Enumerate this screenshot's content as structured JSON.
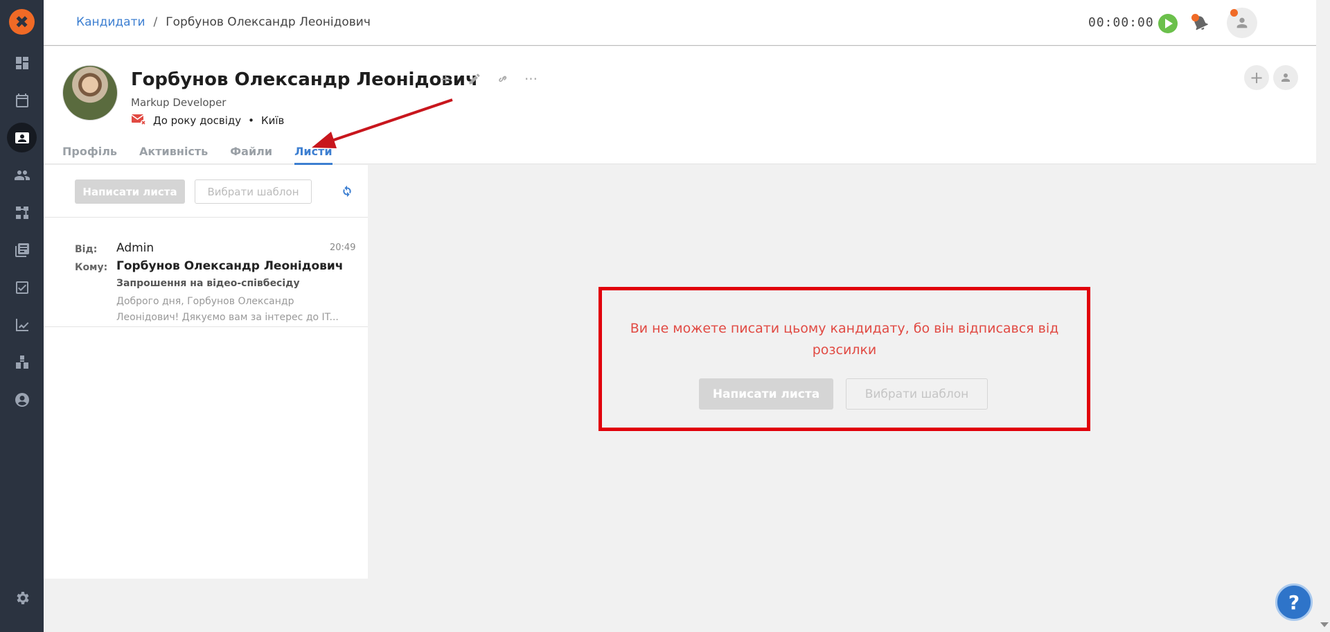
{
  "app": {
    "logo_glyph": "✖",
    "accent_color": "#f06a26",
    "link_color": "#3d7fd1"
  },
  "sidebar": {
    "items": [
      {
        "icon": "dashboard-icon"
      },
      {
        "icon": "calendar-icon"
      },
      {
        "icon": "candidates-icon",
        "active": true
      },
      {
        "icon": "people-icon"
      },
      {
        "icon": "hierarchy-icon"
      },
      {
        "icon": "library-icon"
      },
      {
        "icon": "tasks-icon"
      },
      {
        "icon": "analytics-icon"
      },
      {
        "icon": "boxes-icon"
      },
      {
        "icon": "account-icon"
      },
      {
        "icon": "settings-icon"
      }
    ]
  },
  "topbar": {
    "breadcrumb": {
      "parent": "Кандидати",
      "separator": "/",
      "current": "Горбунов Олександр Леонідович"
    },
    "timer": "00:00:00"
  },
  "candidate": {
    "name": "Горбунов Олександр Леонідович",
    "position": "Markup Developer",
    "experience": "До року досвіду",
    "meta_separator": "•",
    "city": "Київ",
    "tools": {
      "add": "+",
      "more": "···"
    }
  },
  "header_actions": {
    "add": "+"
  },
  "tabs": [
    {
      "label": "Профіль",
      "active": false
    },
    {
      "label": "Активність",
      "active": false
    },
    {
      "label": "Файли",
      "active": false
    },
    {
      "label": "Листи",
      "active": true
    }
  ],
  "mail_panel": {
    "write_label": "Написати листа",
    "template_label": "Вибрати шаблон",
    "items": [
      {
        "from_label": "Від:",
        "from": "Admin",
        "to_label": "Кому:",
        "to": "Горбунов Олександр Леонідович",
        "time": "20:49",
        "subject": "Запрошення на відео-співбесіду",
        "preview": "Доброго дня, Горбунов Олександр Леонідович! Дякуємо вам за інтерес до IT..."
      }
    ]
  },
  "notice": {
    "text": "Ви не можете писати цьому кандидату, бо він відписався від розсилки",
    "write_label": "Написати листа",
    "template_label": "Вибрати шаблон",
    "border_color": "#e1000a",
    "text_color": "#e14a43"
  },
  "help": {
    "label": "?"
  }
}
